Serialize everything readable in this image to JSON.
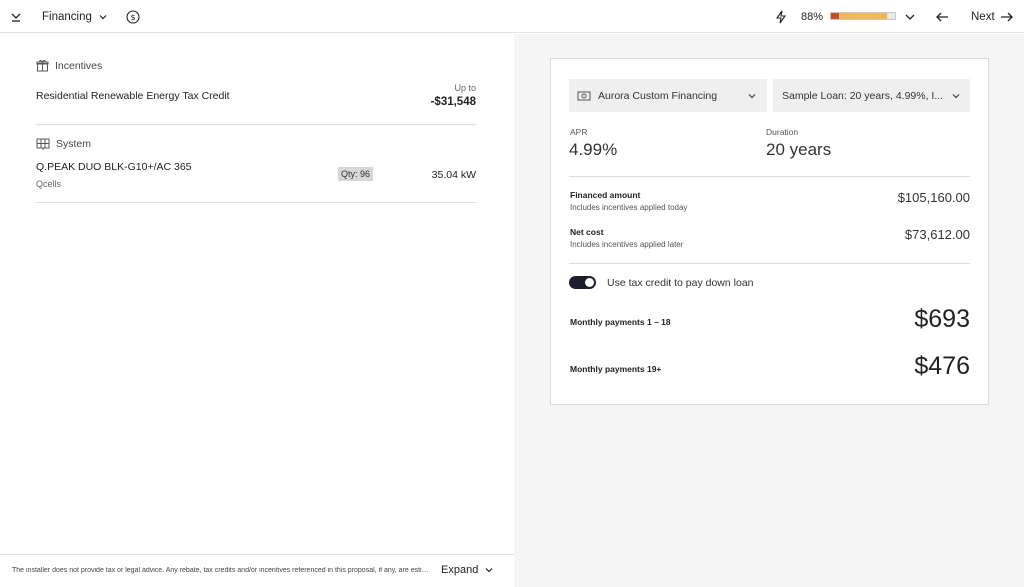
{
  "topbar": {
    "title": "Financing",
    "progress_percent_label": "88%",
    "progress_fraction": 0.88,
    "next_label": "Next"
  },
  "incentives": {
    "heading": "Incentives",
    "item_name": "Residential Renewable Energy Tax Credit",
    "up_to_label": "Up to",
    "amount": "-$31,548"
  },
  "system": {
    "heading": "System",
    "module_name": "Q.PEAK DUO BLK-G10+/AC 365",
    "manufacturer": "Qcells",
    "qty": "Qty: 96",
    "size": "35.04 kW"
  },
  "footer": {
    "disclaimer": "The installer does not provide tax or legal advice. Any rebate, tax credits and/or incentives referenced in this proposal, if any, are estimates only.",
    "expand_label": "Expand"
  },
  "financing": {
    "provider": "Aurora Custom Financing",
    "loan": "Sample Loan: 20 years, 4.99%, I...",
    "apr_label": "APR",
    "apr_value": "4.99%",
    "duration_label": "Duration",
    "duration_value": "20 years",
    "financed_label": "Financed amount",
    "financed_sub": "Includes incentives applied today",
    "financed_value": "$105,160.00",
    "net_label": "Net cost",
    "net_sub": "Includes incentives applied later",
    "net_value": "$73,612.00",
    "toggle_label": "Use tax credit to pay down loan",
    "toggle_on": true,
    "monthly1_label": "Monthly payments 1 – 18",
    "monthly1_value": "$693",
    "monthly2_label": "Monthly payments 19+",
    "monthly2_value": "$476"
  },
  "colors": {
    "progress_fill": "#efb85a",
    "progress_start": "#c0502a",
    "toggle_on": "#1c1f2b"
  }
}
